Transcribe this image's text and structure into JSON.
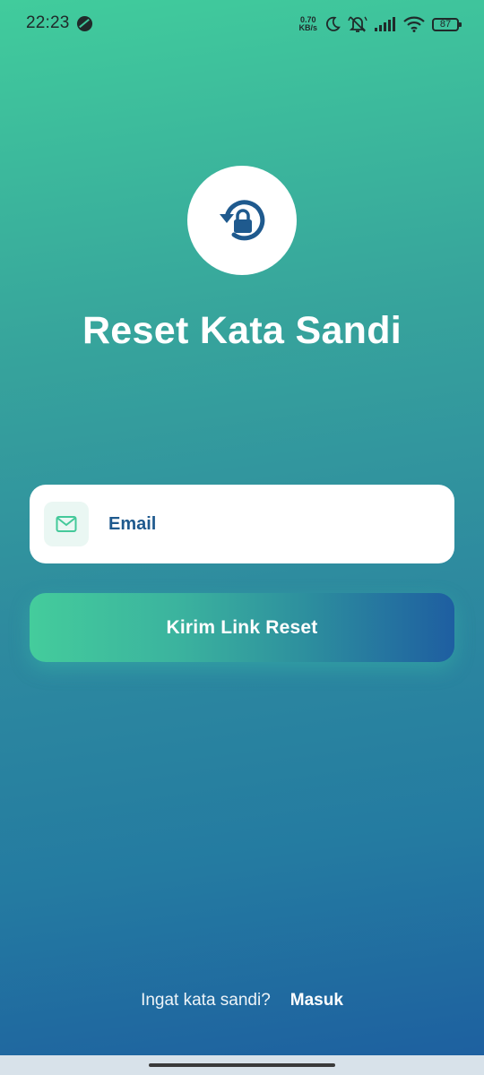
{
  "status_bar": {
    "time": "22:23",
    "net_speed_value": "0.70",
    "net_speed_unit": "KB/s",
    "battery_level": "87",
    "icons": [
      "moon-icon",
      "bell-muted-icon",
      "signal-icon",
      "wifi-icon",
      "battery-icon"
    ]
  },
  "header": {
    "logo_icon": "lock-reset-icon",
    "title": "Reset Kata Sandi"
  },
  "form": {
    "email_icon": "mail-icon",
    "email_placeholder": "Email",
    "email_value": "",
    "submit_label": "Kirim Link Reset"
  },
  "footer": {
    "prompt": "Ingat kata sandi?",
    "login_label": "Masuk"
  },
  "colors": {
    "gradient_top": "#41cc9c",
    "gradient_bottom": "#1d5ea0",
    "accent_blue": "#1f5a8e",
    "accent_green": "#44cc9c"
  }
}
